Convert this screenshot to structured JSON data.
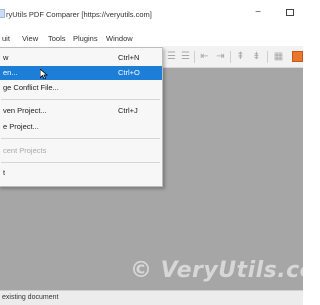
{
  "window": {
    "title": "ryUtils PDF Comparer [https://veryutils.com]",
    "minimize_glyph": "−",
    "maximize_glyph": ""
  },
  "menubar": {
    "items": [
      "uit",
      "View",
      "Tools",
      "Plugins",
      "Window"
    ]
  },
  "file_menu": {
    "items": [
      {
        "label": "w",
        "shortcut": "Ctrl+N"
      },
      {
        "label": "en...",
        "shortcut": "Ctrl+O",
        "active": true
      },
      {
        "label": "ge Conflict File...",
        "shortcut": ""
      },
      {
        "label": "ven Project...",
        "shortcut": "Ctrl+J"
      },
      {
        "label": "e Project...",
        "shortcut": ""
      },
      {
        "label": "cent Projects",
        "shortcut": "",
        "disabled": true
      },
      {
        "label": "t",
        "shortcut": ""
      }
    ]
  },
  "toolbar": {
    "icons": [
      "align-left-icon",
      "align-right-icon",
      "arrow-left-icon",
      "arrow-right-icon",
      "prev-diff-icon",
      "next-diff-icon",
      "color-icon"
    ]
  },
  "watermark": "© VeryUtils.co",
  "status": {
    "text": "existing document"
  },
  "colors": {
    "workspace": "#a6a6a6",
    "highlight": "#1c7ed6",
    "toolbar_accent": "#e8762c"
  }
}
